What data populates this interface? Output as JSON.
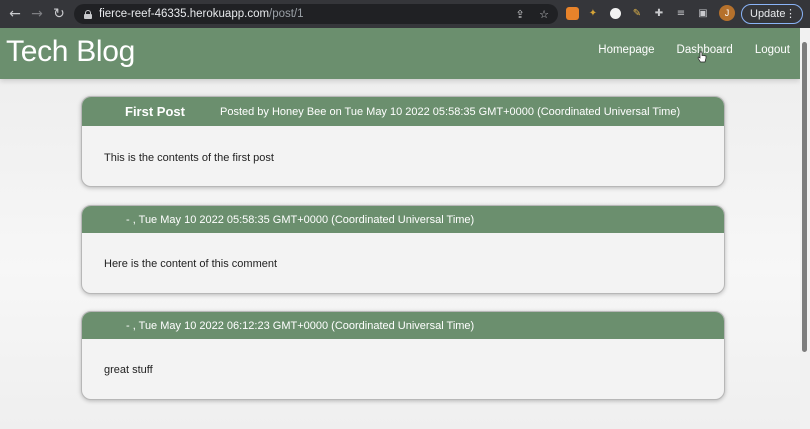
{
  "browser": {
    "url_host": "fierce-reef-46335.herokuapp.com",
    "url_path": "/post/1",
    "update_label": "Update",
    "avatar_letter": "J"
  },
  "site": {
    "title": "Tech Blog",
    "nav": [
      "Homepage",
      "Dashboard",
      "Logout"
    ]
  },
  "post": {
    "title": "First Post",
    "meta": "Posted by Honey Bee on Tue May 10 2022 05:58:35 GMT+0000 (Coordinated Universal Time)",
    "content": "This is the contents of the first post"
  },
  "comments": [
    {
      "meta": "- , Tue May 10 2022 05:58:35 GMT+0000 (Coordinated Universal Time)",
      "content": "Here is the content of this comment"
    },
    {
      "meta": "- , Tue May 10 2022 06:12:23 GMT+0000 (Coordinated Universal Time)",
      "content": "great stuff"
    }
  ],
  "colors": {
    "header_green": "#6b8f6e",
    "card_bg": "#f3f3f3"
  }
}
